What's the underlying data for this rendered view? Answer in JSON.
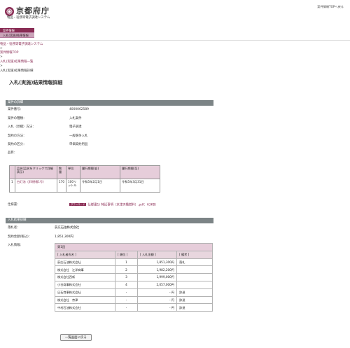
{
  "header": {
    "logo_text": "京都府庁",
    "subtitle": "物品・役務等電子調達システム",
    "toplink": "案件情報TOPへ戻る"
  },
  "nav": {
    "items": [
      {
        "label": "案件情報"
      },
      {
        "label": "入札(実施)結果情報"
      }
    ]
  },
  "breadcrumb": {
    "items": [
      "物品・役務等電子調達システム",
      "案件情報TOP",
      "入札(実施)結果情報一覧"
    ],
    "separator": ">",
    "current": "入札(実施)結果情報詳細"
  },
  "page_title": "入札(実施)結果情報詳細",
  "case_section": {
    "title": "案件の詳細",
    "rows": [
      {
        "label": "案件番号：",
        "value": "4000062589"
      },
      {
        "label": "案件の種類：",
        "value": "入札案件"
      },
      {
        "label": "入札（見積）方法：",
        "value": "電子調達"
      },
      {
        "label": "契約の方法：",
        "value": "一般競争入札"
      },
      {
        "label": "契約の区分：",
        "value": "単価契約用品"
      }
    ],
    "item_label": "品目："
  },
  "items_table": {
    "headers": [
      "品名(品名をクリックで詳細表示)",
      "数量",
      "単位",
      "履行期間(自)",
      "履行期間(至)"
    ],
    "rows": [
      {
        "no": "1",
        "name": "白灯油（JIS規格1号）",
        "qty": "170",
        "unit": "100リットル",
        "from": "令和5年2月1日",
        "to": "令和5年3月31日"
      }
    ]
  },
  "spec": {
    "label": "仕様書：",
    "badge": "ダウンロード",
    "link": "仕様書1) 特記事項（京津天橋燃料）.pdf：63KB）"
  },
  "result_section": {
    "title": "入札結果詳細",
    "rows": [
      {
        "label": "落札者：",
        "value": "荻広石油株式会社"
      },
      {
        "label": "契約金額(税込)：",
        "value": "1,851,300円"
      }
    ],
    "bid_label": "入札情報："
  },
  "bids_table": {
    "round": "第1回",
    "headers": [
      "[ 入札者氏名 ]",
      "[ 順位 ]",
      "[ 入札金額 ]",
      "[ 備考 ]"
    ],
    "rows": [
      {
        "name": "荻広石油株式会社",
        "rank": "1",
        "amount": "1,851,300円",
        "note": "落札"
      },
      {
        "name": "株式会社　江洋商事",
        "rank": "2",
        "amount": "1,982,200円",
        "note": ""
      },
      {
        "name": "株式会社西新",
        "rank": "3",
        "amount": "1,999,000円",
        "note": ""
      },
      {
        "name": "小谷商事株式会社",
        "rank": "4",
        "amount": "2,057,000円",
        "note": ""
      },
      {
        "name": "日石商事株式会社",
        "rank": "-",
        "amount": "- 円",
        "note": "辞退"
      },
      {
        "name": "株式会社　京津",
        "rank": "-",
        "amount": "- 円",
        "note": "辞退"
      },
      {
        "name": "中村石油株式会社",
        "rank": "-",
        "amount": "- 円",
        "note": "辞退"
      }
    ]
  },
  "back_button": "一覧画面に戻る"
}
